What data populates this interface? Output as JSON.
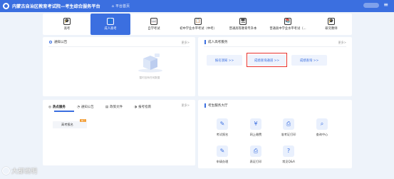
{
  "header": {
    "app_title": "内蒙古自治区教育考试院—考生综合服务平台",
    "home_label": "平台首页",
    "home_icon": "home-icon",
    "menu_icon": "menu-icon"
  },
  "nav": {
    "tiles": [
      {
        "label": "高考",
        "icon": "graduation-cap-icon",
        "glyph": "🎓",
        "active": false
      },
      {
        "label": "成人高考",
        "icon": "person-icon",
        "glyph": "👤",
        "active": true
      },
      {
        "label": "自学考试",
        "icon": "book-icon",
        "glyph": "📖",
        "active": false
      },
      {
        "label": "初中学业水平考试（中考）",
        "icon": "clipboard-icon",
        "glyph": "📋",
        "active": false
      },
      {
        "label": "普通高等教育专升本",
        "icon": "monitor-icon",
        "glyph": "🖥",
        "active": false
      },
      {
        "label": "普通高中学业水平考试（...",
        "icon": "book-open-icon",
        "glyph": "📚",
        "active": false
      },
      {
        "label": "研究教师",
        "icon": "cap-icon",
        "glyph": "🎓",
        "active": false
      }
    ]
  },
  "notice_card": {
    "title": "通知公告",
    "more": "更多>",
    "empty_text": "暂时没有任何数据",
    "empty_icon": "empty-box-icon"
  },
  "exam_entry_card": {
    "title": "成人高考服务",
    "more": "更多>",
    "buttons": [
      {
        "label": "报名须知 >>"
      },
      {
        "label": "成绩查询通道 >>"
      },
      {
        "label": "成绩查询 >>"
      }
    ],
    "highlighted_index": 1,
    "highlight_color": "#e8322e"
  },
  "news_card": {
    "tabs": [
      {
        "label": "热点服务",
        "icon": "target-icon",
        "active": true
      },
      {
        "label": "通知公告",
        "icon": "bell-icon",
        "active": false
      },
      {
        "label": "政策文件",
        "icon": "document-icon",
        "active": false
      },
      {
        "label": "报考指南",
        "icon": "compass-icon",
        "active": false
      }
    ],
    "more": "更多>",
    "items": [
      {
        "label": "高考报名",
        "badge": "热门"
      }
    ]
  },
  "services_card": {
    "title": "考生服务大厅",
    "items": [
      {
        "label": "考试报名",
        "icon": "edit-icon",
        "glyph": "✎"
      },
      {
        "label": "网上缴费",
        "icon": "payment-icon",
        "glyph": "¥"
      },
      {
        "label": "准考证打印",
        "icon": "print-icon",
        "glyph": "⎙"
      },
      {
        "label": "查询中心",
        "icon": "search-doc-icon",
        "glyph": "⌕"
      },
      {
        "label": "申请办理",
        "icon": "application-icon",
        "glyph": "✎"
      },
      {
        "label": "表证打印",
        "icon": "printer-icon",
        "glyph": "⎙"
      },
      {
        "label": "常见Q&A",
        "icon": "qa-icon",
        "glyph": "?"
      }
    ]
  },
  "watermark": {
    "text": "大都说明"
  },
  "colors": {
    "accent": "#3b6fe0",
    "background": "#eef3fa",
    "highlight": "#e8322e",
    "badge": "#f29a2e"
  }
}
